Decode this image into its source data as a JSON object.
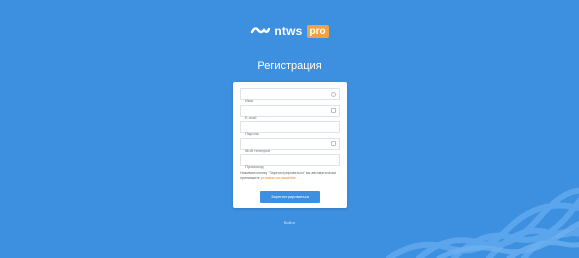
{
  "logo": {
    "text": "ntws",
    "badge": "pro"
  },
  "page_title": "Регистрация",
  "form": {
    "fields": [
      {
        "placeholder": "Имя",
        "icon": "info-icon"
      },
      {
        "placeholder": "E-mail",
        "icon": "mail-icon"
      },
      {
        "placeholder": "Пароль",
        "icon": ""
      },
      {
        "placeholder": "Мой телефон",
        "icon": "phone-icon"
      },
      {
        "placeholder": "Промокод",
        "icon": ""
      }
    ],
    "terms_text": "Нажимая кнопку \"Зарегистрироваться\" вы автоматически принимаете",
    "terms_link": "условия соглашения",
    "submit_label": "Зарегистрироваться"
  },
  "login_link": "Войти",
  "colors": {
    "background": "#3d8fe0",
    "accent": "#f0a24b",
    "card": "#ffffff"
  }
}
